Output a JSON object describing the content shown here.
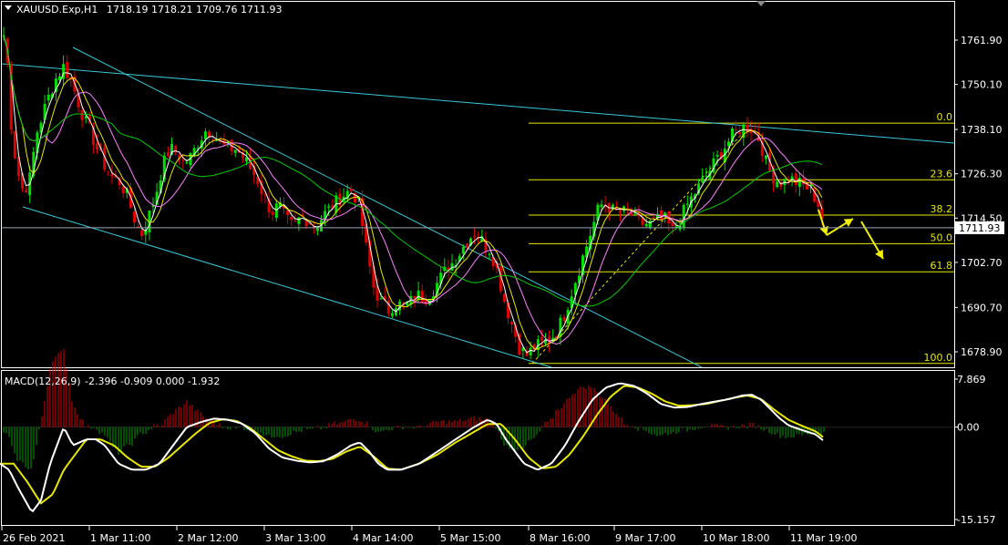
{
  "header": {
    "symbol": "XAUUSD.Exp,H1",
    "ohlc": "1718.19 1718.21 1709.76 1711.93"
  },
  "macd_header": {
    "label": "MACD(12,26,9)",
    "values": "-2.396 -0.909 0.000 -1.932"
  },
  "price_axis": {
    "ticks": [
      "1761.90",
      "1750.10",
      "1738.10",
      "1726.30",
      "1714.50",
      "1702.70",
      "1690.70",
      "1678.90"
    ],
    "tick_values": [
      1761.9,
      1750.1,
      1738.1,
      1726.3,
      1714.5,
      1702.7,
      1690.7,
      1678.9
    ],
    "current_price": "1711.93",
    "current_value": 1711.93
  },
  "macd_axis": {
    "ticks": [
      "7.869",
      "0.00",
      "-15.157"
    ],
    "tick_values": [
      7.869,
      0.0,
      -15.157
    ]
  },
  "time_axis": {
    "labels": [
      "26 Feb 2021",
      "1 Mar 11:00",
      "2 Mar 12:00",
      "3 Mar 13:00",
      "4 Mar 14:00",
      "5 Mar 15:00",
      "8 Mar 16:00",
      "9 Mar 17:00",
      "10 Mar 18:00",
      "11 Mar 19:00"
    ]
  },
  "fibonacci": {
    "levels": [
      {
        "label": "0.0",
        "price": 1739.8
      },
      {
        "label": "23.6",
        "price": 1724.7
      },
      {
        "label": "38.2",
        "price": 1715.3
      },
      {
        "label": "50.0",
        "price": 1707.7
      },
      {
        "label": "61.8",
        "price": 1700.2
      },
      {
        "label": "100.0",
        "price": 1675.8
      }
    ],
    "color": "#e8e800"
  },
  "chart_data": {
    "type": "candlestick",
    "bull_color": "#00e000",
    "bear_color": "#e00000",
    "close_path": [
      [
        0,
        1760
      ],
      [
        3,
        1765
      ],
      [
        8,
        1756
      ],
      [
        12,
        1740
      ],
      [
        18,
        1728
      ],
      [
        25,
        1722
      ],
      [
        32,
        1724
      ],
      [
        40,
        1737
      ],
      [
        48,
        1743
      ],
      [
        55,
        1748
      ],
      [
        62,
        1752
      ],
      [
        70,
        1755
      ],
      [
        78,
        1751
      ],
      [
        85,
        1746
      ],
      [
        92,
        1741
      ],
      [
        100,
        1737
      ],
      [
        108,
        1732
      ],
      [
        116,
        1728
      ],
      [
        124,
        1725
      ],
      [
        132,
        1724
      ],
      [
        140,
        1720
      ],
      [
        148,
        1714
      ],
      [
        155,
        1710
      ],
      [
        162,
        1714
      ],
      [
        170,
        1720
      ],
      [
        178,
        1728
      ],
      [
        186,
        1733
      ],
      [
        194,
        1732
      ],
      [
        202,
        1729
      ],
      [
        210,
        1731
      ],
      [
        218,
        1735
      ],
      [
        226,
        1738
      ],
      [
        234,
        1737
      ],
      [
        242,
        1734
      ],
      [
        250,
        1733
      ],
      [
        258,
        1733
      ],
      [
        266,
        1731
      ],
      [
        274,
        1728
      ],
      [
        282,
        1725
      ],
      [
        290,
        1720
      ],
      [
        298,
        1716
      ],
      [
        306,
        1718
      ],
      [
        314,
        1714
      ],
      [
        322,
        1712
      ],
      [
        330,
        1715
      ],
      [
        338,
        1714
      ],
      [
        346,
        1712
      ],
      [
        354,
        1715
      ],
      [
        362,
        1717
      ],
      [
        370,
        1719
      ],
      [
        378,
        1721
      ],
      [
        386,
        1722
      ],
      [
        394,
        1718
      ],
      [
        402,
        1706
      ],
      [
        410,
        1696
      ],
      [
        418,
        1692
      ],
      [
        426,
        1690
      ],
      [
        434,
        1692
      ],
      [
        442,
        1691
      ],
      [
        450,
        1692
      ],
      [
        458,
        1694
      ],
      [
        466,
        1693
      ],
      [
        474,
        1695
      ],
      [
        482,
        1698
      ],
      [
        490,
        1701
      ],
      [
        498,
        1703
      ],
      [
        506,
        1706
      ],
      [
        514,
        1709
      ],
      [
        522,
        1711
      ],
      [
        530,
        1708
      ],
      [
        538,
        1706
      ],
      [
        546,
        1700
      ],
      [
        554,
        1692
      ],
      [
        562,
        1686
      ],
      [
        570,
        1680
      ],
      [
        578,
        1678
      ],
      [
        586,
        1680
      ],
      [
        594,
        1681
      ],
      [
        602,
        1682
      ],
      [
        610,
        1684
      ],
      [
        618,
        1688
      ],
      [
        626,
        1694
      ],
      [
        634,
        1700
      ],
      [
        642,
        1706
      ],
      [
        650,
        1712
      ],
      [
        658,
        1718
      ],
      [
        666,
        1718
      ],
      [
        674,
        1716
      ],
      [
        682,
        1716
      ],
      [
        690,
        1716
      ],
      [
        698,
        1714
      ],
      [
        706,
        1713
      ],
      [
        714,
        1713
      ],
      [
        722,
        1714
      ],
      [
        730,
        1714
      ],
      [
        738,
        1711
      ],
      [
        746,
        1714
      ],
      [
        754,
        1718
      ],
      [
        762,
        1721
      ],
      [
        770,
        1724
      ],
      [
        778,
        1727
      ],
      [
        786,
        1730
      ],
      [
        794,
        1733
      ],
      [
        802,
        1736
      ],
      [
        810,
        1738
      ],
      [
        818,
        1739
      ],
      [
        826,
        1738
      ],
      [
        834,
        1735
      ],
      [
        842,
        1728
      ],
      [
        850,
        1725
      ],
      [
        858,
        1724
      ],
      [
        866,
        1725
      ],
      [
        874,
        1724
      ],
      [
        882,
        1723
      ],
      [
        890,
        1722
      ],
      [
        898,
        1718
      ],
      [
        905,
        1712
      ]
    ],
    "moving_averages": [
      {
        "name": "MA-fast",
        "color": "#ffffff",
        "period": 3
      },
      {
        "name": "MA-medium",
        "color": "#e8e800",
        "period": 6
      },
      {
        "name": "MA-slow",
        "color": "#ff80ff",
        "period": 12
      },
      {
        "name": "MA-long",
        "color": "#00cc00",
        "period": 30
      }
    ],
    "macd": {
      "main": [
        [
          0,
          -6
        ],
        [
          10,
          -7
        ],
        [
          20,
          -10
        ],
        [
          35,
          -14
        ],
        [
          45,
          -12
        ],
        [
          55,
          -6
        ],
        [
          70,
          0
        ],
        [
          80,
          -3
        ],
        [
          95,
          -2
        ],
        [
          105,
          -2
        ],
        [
          115,
          -3
        ],
        [
          130,
          -6
        ],
        [
          145,
          -7
        ],
        [
          160,
          -7
        ],
        [
          175,
          -6
        ],
        [
          190,
          -3
        ],
        [
          205,
          0
        ],
        [
          220,
          0.8
        ],
        [
          235,
          1.4
        ],
        [
          250,
          1.2
        ],
        [
          265,
          0.6
        ],
        [
          280,
          -1
        ],
        [
          295,
          -3.5
        ],
        [
          310,
          -5
        ],
        [
          325,
          -5.5
        ],
        [
          340,
          -5.8
        ],
        [
          355,
          -5.6
        ],
        [
          370,
          -4.5
        ],
        [
          385,
          -3
        ],
        [
          395,
          -2.5
        ],
        [
          405,
          -4
        ],
        [
          415,
          -6
        ],
        [
          425,
          -7
        ],
        [
          440,
          -7
        ],
        [
          460,
          -6
        ],
        [
          480,
          -4
        ],
        [
          500,
          -2
        ],
        [
          520,
          0
        ],
        [
          535,
          1.2
        ],
        [
          545,
          0.5
        ],
        [
          555,
          -2
        ],
        [
          565,
          -4
        ],
        [
          575,
          -6
        ],
        [
          590,
          -7
        ],
        [
          605,
          -6
        ],
        [
          620,
          -3
        ],
        [
          635,
          1
        ],
        [
          650,
          4.5
        ],
        [
          665,
          6.5
        ],
        [
          680,
          7.2
        ],
        [
          695,
          6.8
        ],
        [
          710,
          5.5
        ],
        [
          725,
          3.8
        ],
        [
          740,
          3.2
        ],
        [
          755,
          3.3
        ],
        [
          770,
          3.8
        ],
        [
          785,
          4.2
        ],
        [
          800,
          4.6
        ],
        [
          815,
          5.2
        ],
        [
          825,
          5.3
        ],
        [
          835,
          4.5
        ],
        [
          845,
          3
        ],
        [
          855,
          1.5
        ],
        [
          865,
          0.3
        ],
        [
          880,
          -0.5
        ],
        [
          895,
          -1.2
        ],
        [
          905,
          -2.4
        ]
      ],
      "signal": [
        [
          0,
          -6
        ],
        [
          15,
          -6
        ],
        [
          30,
          -9
        ],
        [
          45,
          -12.5
        ],
        [
          58,
          -11
        ],
        [
          70,
          -7
        ],
        [
          80,
          -5
        ],
        [
          95,
          -2
        ],
        [
          110,
          -2
        ],
        [
          125,
          -3
        ],
        [
          140,
          -5
        ],
        [
          155,
          -6.5
        ],
        [
          170,
          -6.5
        ],
        [
          185,
          -5
        ],
        [
          200,
          -3
        ],
        [
          215,
          -1
        ],
        [
          230,
          0.7
        ],
        [
          245,
          1.3
        ],
        [
          260,
          1
        ],
        [
          275,
          -0.2
        ],
        [
          290,
          -2
        ],
        [
          305,
          -3.8
        ],
        [
          320,
          -4.8
        ],
        [
          335,
          -5.5
        ],
        [
          350,
          -5.6
        ],
        [
          365,
          -5.2
        ],
        [
          380,
          -4
        ],
        [
          395,
          -3.2
        ],
        [
          410,
          -4.8
        ],
        [
          425,
          -6.8
        ],
        [
          440,
          -7
        ],
        [
          460,
          -6
        ],
        [
          480,
          -4.5
        ],
        [
          500,
          -2.5
        ],
        [
          520,
          -0.8
        ],
        [
          535,
          0.5
        ],
        [
          550,
          0.5
        ],
        [
          565,
          -2
        ],
        [
          580,
          -5
        ],
        [
          595,
          -6.8
        ],
        [
          610,
          -6.5
        ],
        [
          625,
          -4.5
        ],
        [
          640,
          -1.5
        ],
        [
          655,
          2
        ],
        [
          670,
          5
        ],
        [
          685,
          6.8
        ],
        [
          700,
          6.5
        ],
        [
          715,
          5.5
        ],
        [
          730,
          4.2
        ],
        [
          745,
          3.5
        ],
        [
          760,
          3.6
        ],
        [
          775,
          3.8
        ],
        [
          790,
          4.3
        ],
        [
          805,
          4.8
        ],
        [
          820,
          5.2
        ],
        [
          835,
          4.6
        ],
        [
          850,
          2.8
        ],
        [
          865,
          1.2
        ],
        [
          880,
          0.2
        ],
        [
          895,
          -0.7
        ],
        [
          905,
          -1.9
        ]
      ],
      "hist_color_pos": "#e00000",
      "hist_color_neg": "#00a000",
      "main_color": "#ffffff",
      "signal_color": "#e8e800"
    }
  },
  "colors": {
    "background": "#000000",
    "trendline": "#38c8d8",
    "grid_line": "#ffffff",
    "arrow": "#f0f000"
  }
}
